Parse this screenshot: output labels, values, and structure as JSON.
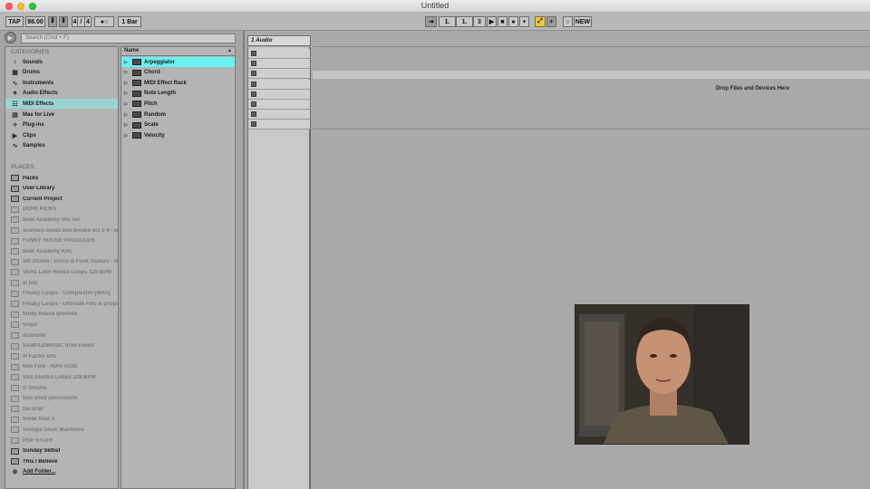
{
  "window": {
    "title": "Untitled"
  },
  "toolbar": {
    "tap": "TAP",
    "tempo": "98.00",
    "sig_num": "4",
    "sig_sep": "/",
    "sig_den": "4",
    "metro": "●○",
    "quantize": "1 Bar",
    "pos1": "1.",
    "pos2": "1.",
    "pos3": "3",
    "new_label": "NEW"
  },
  "browser": {
    "search_placeholder": "Search (Cmd + F)",
    "categories_header": "CATEGORIES",
    "categories": [
      {
        "label": "Sounds",
        "icon": "♪"
      },
      {
        "label": "Drums",
        "icon": "▦"
      },
      {
        "label": "Instruments",
        "icon": "∿"
      },
      {
        "label": "Audio Effects",
        "icon": "✶"
      },
      {
        "label": "MIDI Effects",
        "icon": "☷",
        "selected": true
      },
      {
        "label": "Max for Live",
        "icon": "▤"
      },
      {
        "label": "Plug-ins",
        "icon": "✧"
      },
      {
        "label": "Clips",
        "icon": "▶"
      },
      {
        "label": "Samples",
        "icon": "∿"
      }
    ],
    "places_header": "PLACES",
    "places": [
      {
        "label": "Packs",
        "dim": false
      },
      {
        "label": "User Library",
        "dim": false
      },
      {
        "label": "Current Project",
        "dim": false
      },
      {
        "label": "DOPE KICKS",
        "dim": true
      },
      {
        "label": "Beat Academy live set",
        "dim": true
      },
      {
        "label": "scarface beats and breaks vol 1-4 - w",
        "dim": true
      },
      {
        "label": "FUNKY HOUSE PRODUCER",
        "dim": true
      },
      {
        "label": "Beat Academy Kits",
        "dim": true
      },
      {
        "label": "SM Studio - Disco & Funk Guitars - W",
        "dim": true
      },
      {
        "label": "VEH1 Latin House Loops 128 BPM",
        "dim": true
      },
      {
        "label": "lil kitz",
        "dim": true
      },
      {
        "label": "Freaky Loops - Complextro [WAV]",
        "dim": true
      },
      {
        "label": "Freaky Loops - Ultimate Fills & Drops",
        "dim": true
      },
      {
        "label": "funky house grooves",
        "dim": true
      },
      {
        "label": "loops",
        "dim": true
      },
      {
        "label": "iltransfer",
        "dim": true
      },
      {
        "label": "SAMPLEMAGIC from robert",
        "dim": true
      },
      {
        "label": "Ill Factor bits",
        "dim": true
      },
      {
        "label": "Neo Folk - WAV-ACID",
        "dim": true
      },
      {
        "label": "VEE Electro Loops 128 BPM",
        "dim": true
      },
      {
        "label": "G Strums",
        "dim": true
      },
      {
        "label": "tool shed percussion",
        "dim": true
      },
      {
        "label": "Da Grail",
        "dim": true
      },
      {
        "label": "break beat 3",
        "dim": true
      },
      {
        "label": "Vintage Drum Machines",
        "dim": true
      },
      {
        "label": "POP STUFF",
        "dim": true
      },
      {
        "label": "Sunday Setlist",
        "dim": false
      },
      {
        "label": "This I Believe",
        "dim": false
      }
    ],
    "add_folder": "Add Folder...",
    "name_header": "Name",
    "items": [
      {
        "label": "Arpeggiator",
        "selected": true
      },
      {
        "label": "Chord"
      },
      {
        "label": "MIDI Effect Rack"
      },
      {
        "label": "Note Length"
      },
      {
        "label": "Pitch"
      },
      {
        "label": "Random"
      },
      {
        "label": "Scale"
      },
      {
        "label": "Velocity"
      }
    ]
  },
  "arrangement": {
    "track_name": "1 Audio",
    "drop_text": "Drop Files and Devices Here"
  },
  "colors": {
    "selection": "#6af1f1",
    "category_selection": "#9bd3d3",
    "arm": "#f4c730"
  }
}
